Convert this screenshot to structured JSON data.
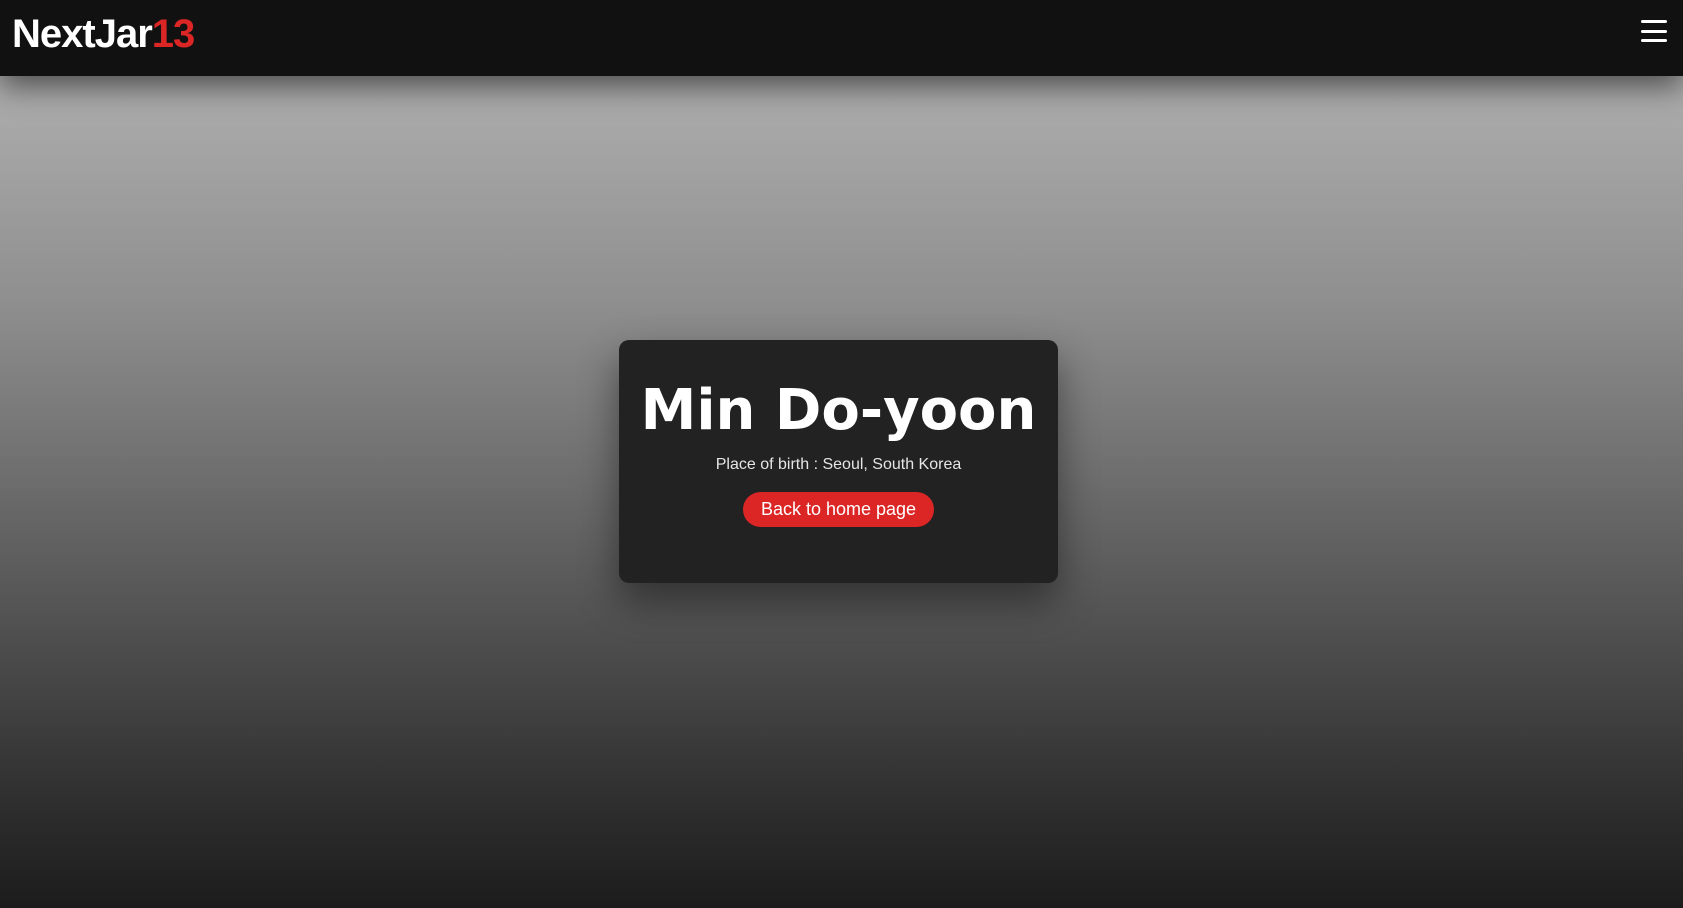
{
  "navbar": {
    "logo_text": "NextJar",
    "logo_accent": "13",
    "menu_icon": "hamburger-menu-icon"
  },
  "profile": {
    "name": "Min Do-yoon",
    "place_of_birth_label": "Place of birth : Seoul, South Korea",
    "back_button_label": "Back to home page"
  },
  "colors": {
    "navbar_bg": "#111111",
    "card_bg": "#222222",
    "accent": "#dc2626",
    "text": "#ffffff"
  }
}
